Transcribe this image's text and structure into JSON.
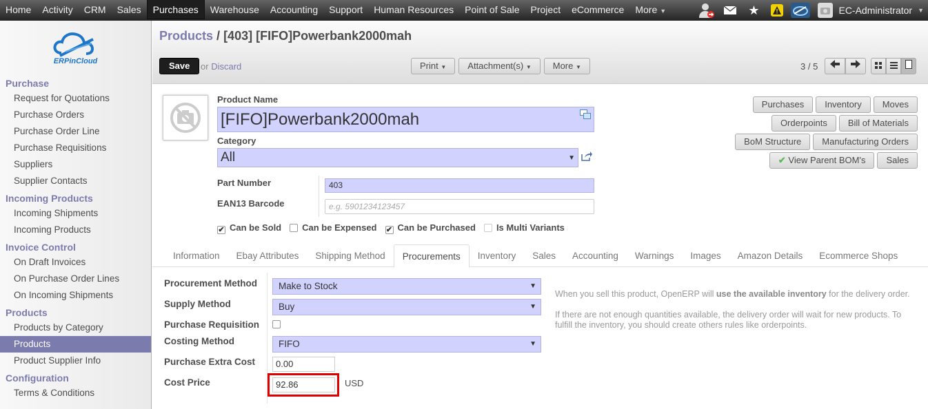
{
  "topmenu": [
    "Home",
    "Activity",
    "CRM",
    "Sales",
    "Purchases",
    "Warehouse",
    "Accounting",
    "Support",
    "Human Resources",
    "Point of Sale",
    "Project",
    "eCommerce",
    "More"
  ],
  "user": {
    "name": "EC-Administrator"
  },
  "logo": {
    "text": "ERPinCloud"
  },
  "sidebar": [
    {
      "section": "Purchase",
      "items": [
        "Request for Quotations",
        "Purchase Orders",
        "Purchase Order Line",
        "Purchase Requisitions",
        "Suppliers",
        "Supplier Contacts"
      ]
    },
    {
      "section": "Incoming Products",
      "items": [
        "Incoming Shipments",
        "Incoming Products"
      ]
    },
    {
      "section": "Invoice Control",
      "items": [
        "On Draft Invoices",
        "On Purchase Order Lines",
        "On Incoming Shipments"
      ]
    },
    {
      "section": "Products",
      "items": [
        "Products by Category",
        "Products",
        "Product Supplier Info"
      ]
    },
    {
      "section": "Configuration",
      "items": [
        "Terms & Conditions"
      ]
    }
  ],
  "breadcrumb": {
    "root": "Products",
    "sep": "/",
    "current": "[403] [FIFO]Powerbank2000mah"
  },
  "toolbar": {
    "save": "Save",
    "or": "or",
    "discard": "Discard",
    "print": "Print",
    "attachments": "Attachment(s)",
    "more": "More",
    "pager": "3 / 5"
  },
  "form": {
    "name_label": "Product Name",
    "name": "[FIFO]Powerbank2000mah",
    "category_label": "Category",
    "category": "All",
    "part_number_label": "Part Number",
    "part_number": "403",
    "ean_label": "EAN13 Barcode",
    "ean_placeholder": "e.g. 5901234123457",
    "checks": [
      {
        "label": "Can be Sold",
        "checked": true
      },
      {
        "label": "Can be Expensed",
        "checked": false
      },
      {
        "label": "Can be Purchased",
        "checked": true
      },
      {
        "label": "Is Multi Variants",
        "checked": false
      }
    ]
  },
  "smart_buttons": [
    [
      "Purchases",
      "Inventory",
      "Moves"
    ],
    [
      "Orderpoints",
      "Bill of Materials"
    ],
    [
      "BoM Structure",
      "Manufacturing Orders"
    ],
    [
      "View Parent BOM's",
      "Sales"
    ]
  ],
  "tabs": [
    "Information",
    "Ebay Attributes",
    "Shipping Method",
    "Procurements",
    "Inventory",
    "Sales",
    "Accounting",
    "Warnings",
    "Images",
    "Amazon Details",
    "Ecommerce Shops"
  ],
  "active_tab": "Procurements",
  "procurement": {
    "method_label": "Procurement Method",
    "method": "Make to Stock",
    "supply_label": "Supply Method",
    "supply": "Buy",
    "req_label": "Purchase Requisition",
    "costing_label": "Costing Method",
    "costing": "FIFO",
    "extra_label": "Purchase Extra Cost",
    "extra": "0.00",
    "cost_label": "Cost Price",
    "cost": "92.86",
    "currency": "USD",
    "help1_pre": "When you sell this product, OpenERP will ",
    "help1_bold": "use the available inventory",
    "help1_post": " for the delivery order.",
    "help2": "If there are not enough quantities available, the delivery order will wait for new products. To fulfill the inventory, you should create others rules like orderpoints."
  },
  "colors": {
    "accent": "#7c7bad",
    "highlight_field": "#d2d2ff",
    "annotation": "#e00000"
  }
}
